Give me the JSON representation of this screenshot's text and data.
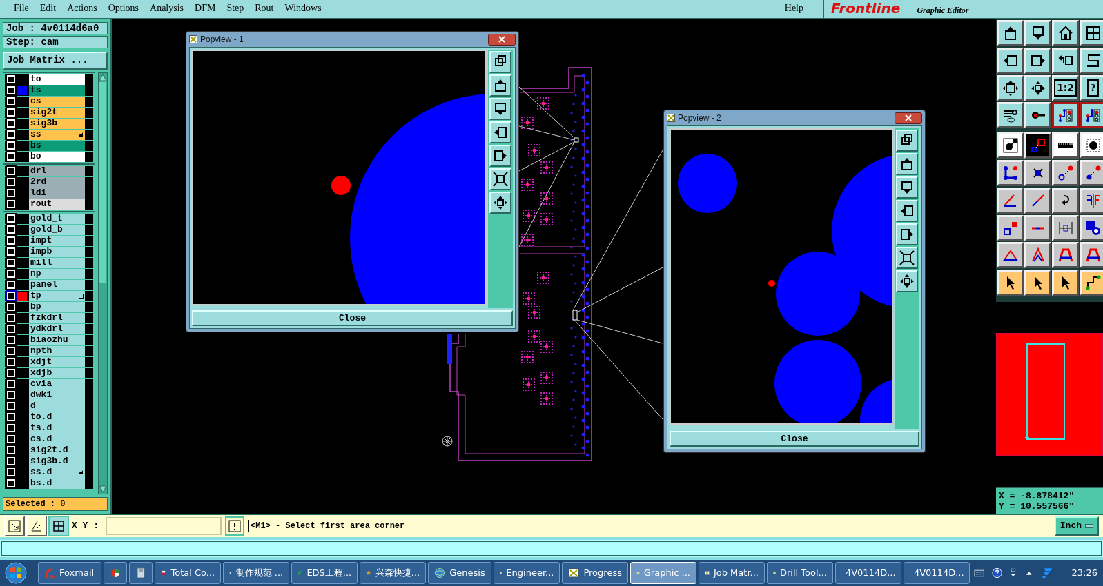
{
  "menu": [
    "File",
    "Edit",
    "Actions",
    "Options",
    "Analysis",
    "DFM",
    "Step",
    "Rout",
    "Windows"
  ],
  "help_menu": "Help",
  "logo": {
    "text": "Frontline",
    "subtitle": "Graphic Editor"
  },
  "job_label": "Job : 4v0114d6a0",
  "step_label": "Step: cam",
  "job_matrix_button": "Job Matrix ...",
  "layer_groups": [
    {
      "layers": [
        {
          "name": "to",
          "kind": "silk",
          "checked": false,
          "selected": false
        },
        {
          "name": "ts",
          "kind": "mask",
          "color": "#0000ff",
          "checked": false,
          "selected": false
        },
        {
          "name": "cs",
          "kind": "signal",
          "checked": false,
          "selected": false
        },
        {
          "name": "sig2t",
          "kind": "signal",
          "checked": false,
          "selected": false
        },
        {
          "name": "sig3b",
          "kind": "signal",
          "checked": false,
          "selected": false
        },
        {
          "name": "ss",
          "kind": "signal",
          "hand_mark": true,
          "checked": false,
          "selected": false
        },
        {
          "name": "bs",
          "kind": "mask",
          "checked": false,
          "selected": false
        },
        {
          "name": "bo",
          "kind": "silk",
          "checked": false,
          "selected": false
        }
      ]
    },
    {
      "layers": [
        {
          "name": "drl",
          "kind": "drill",
          "checked": false,
          "selected": false
        },
        {
          "name": "2rd",
          "kind": "drill",
          "checked": false,
          "selected": false
        },
        {
          "name": "ldi",
          "kind": "drill",
          "checked": false,
          "selected": false
        },
        {
          "name": "rout",
          "kind": "rout",
          "checked": false,
          "selected": false
        }
      ]
    },
    {
      "layers": [
        {
          "name": "gold_t",
          "kind": "misc",
          "checked": false,
          "selected": false
        },
        {
          "name": "gold_b",
          "kind": "misc",
          "checked": false,
          "selected": false
        },
        {
          "name": "impt",
          "kind": "misc",
          "checked": false,
          "selected": false
        },
        {
          "name": "impb",
          "kind": "misc",
          "checked": false,
          "selected": false
        },
        {
          "name": "mill",
          "kind": "misc",
          "checked": false,
          "selected": false
        },
        {
          "name": "np",
          "kind": "misc",
          "checked": false,
          "selected": false
        },
        {
          "name": "panel",
          "kind": "misc",
          "checked": false,
          "selected": false
        },
        {
          "name": "tp",
          "kind": "misc",
          "color": "#ff0000",
          "grid_mark": true,
          "checked": false,
          "selected": true
        },
        {
          "name": "bp",
          "kind": "misc",
          "checked": false,
          "selected": false
        },
        {
          "name": "fzkdrl",
          "kind": "misc",
          "checked": false,
          "selected": false
        },
        {
          "name": "ydkdrl",
          "kind": "misc",
          "checked": false,
          "selected": false
        },
        {
          "name": "biaozhu",
          "kind": "misc",
          "checked": false,
          "selected": false
        },
        {
          "name": "npth",
          "kind": "misc",
          "checked": false,
          "selected": false
        },
        {
          "name": "xdjt",
          "kind": "misc",
          "checked": false,
          "selected": false
        },
        {
          "name": "xdjb",
          "kind": "misc",
          "checked": false,
          "selected": false
        },
        {
          "name": "cvia",
          "kind": "misc",
          "checked": false,
          "selected": false
        },
        {
          "name": "dwk1",
          "kind": "misc",
          "checked": false,
          "selected": false
        },
        {
          "name": "d",
          "kind": "misc",
          "checked": false,
          "selected": false
        },
        {
          "name": "to.d",
          "kind": "misc",
          "checked": false,
          "selected": false
        },
        {
          "name": "ts.d",
          "kind": "misc",
          "checked": false,
          "selected": false
        },
        {
          "name": "cs.d",
          "kind": "misc",
          "checked": false,
          "selected": false
        },
        {
          "name": "sig2t.d",
          "kind": "misc",
          "checked": false,
          "selected": false
        },
        {
          "name": "sig3b.d",
          "kind": "misc",
          "checked": false,
          "selected": false
        },
        {
          "name": "ss.d",
          "kind": "misc",
          "hand_mark": true,
          "checked": false,
          "selected": false
        },
        {
          "name": "bs.d",
          "kind": "misc",
          "checked": false,
          "selected": false
        }
      ]
    }
  ],
  "selected_label": "Selected : 0",
  "popviews": [
    {
      "title": "Popview - 1",
      "close_button": "Close"
    },
    {
      "title": "Popview - 2",
      "close_button": "Close"
    }
  ],
  "tool_rows": [
    {
      "kind": "view",
      "tools": [
        {
          "kind": "up",
          "selected": false
        },
        {
          "kind": "down",
          "selected": false
        },
        {
          "kind": "house",
          "selected": false
        },
        {
          "kind": "panes",
          "selected": false
        }
      ]
    },
    {
      "kind": "view",
      "tools": [
        {
          "kind": "left",
          "selected": false
        },
        {
          "kind": "right",
          "selected": false
        },
        {
          "kind": "undo",
          "selected": false
        },
        {
          "kind": "zigzag",
          "selected": false
        }
      ]
    },
    {
      "kind": "view",
      "tools": [
        {
          "kind": "fit",
          "selected": false
        },
        {
          "kind": "squeeze",
          "selected": false
        },
        {
          "kind": "text",
          "label": "1:2",
          "selected": false
        },
        {
          "kind": "text",
          "label": "?",
          "selected": false
        }
      ]
    },
    {
      "kind": "view",
      "tools": [
        {
          "kind": "wrench",
          "selected": false
        },
        {
          "kind": "pin",
          "selected": false
        },
        {
          "kind": "circuit",
          "selected": true
        },
        {
          "kind": "circuit",
          "selected": true
        }
      ]
    },
    {
      "kind": "edit",
      "tools": [
        {
          "kind": "dot-arrow",
          "selected": false
        },
        {
          "kind": "snap",
          "selected": false
        },
        {
          "kind": "ruler",
          "selected": false
        },
        {
          "kind": "dot-frame",
          "selected": false
        }
      ]
    },
    {
      "kind": "edit",
      "tools": [
        {
          "kind": "nodes",
          "selected": false
        },
        {
          "kind": "cross",
          "selected": false
        },
        {
          "kind": "ring-arrow",
          "selected": false
        },
        {
          "kind": "dot-arrow2",
          "selected": false
        }
      ]
    },
    {
      "kind": "edit",
      "tools": [
        {
          "kind": "slant",
          "selected": false
        },
        {
          "kind": "slant2",
          "selected": false
        },
        {
          "kind": "curl",
          "selected": false
        },
        {
          "kind": "mirror",
          "selected": false
        }
      ]
    },
    {
      "kind": "edit",
      "tools": [
        {
          "kind": "squares",
          "selected": false
        },
        {
          "kind": "bar",
          "selected": false
        },
        {
          "kind": "measure",
          "selected": false
        },
        {
          "kind": "blobs",
          "selected": false
        }
      ]
    },
    {
      "kind": "edit",
      "tools": [
        {
          "kind": "triangle",
          "selected": false
        },
        {
          "kind": "peak",
          "selected": false
        },
        {
          "kind": "arch",
          "selected": false
        },
        {
          "kind": "arch",
          "selected": false
        }
      ]
    },
    {
      "kind": "select",
      "tools": [
        {
          "kind": "pointer",
          "selected": false
        },
        {
          "kind": "pointer",
          "selected": false
        },
        {
          "kind": "pointer",
          "selected": false
        },
        {
          "kind": "route",
          "selected": false
        }
      ]
    }
  ],
  "coordinates": {
    "x": "X = -8.878412\"",
    "y": "Y = 10.557566\""
  },
  "command_bar": {
    "xy_label": "X Y :",
    "message": "<M1> - Select first area corner",
    "units": "Inch"
  },
  "taskbar": {
    "items": [
      {
        "label": "Foxmail",
        "selected": false
      },
      {
        "selected": false
      },
      {
        "selected": false
      },
      {
        "label": "Total Co...",
        "selected": false
      },
      {
        "label": "制作规范 ...",
        "selected": false
      },
      {
        "label": "EDS工程...",
        "selected": false
      },
      {
        "label": "兴森快捷...",
        "selected": false
      },
      {
        "label": "Genesis",
        "selected": false
      },
      {
        "label": "Engineer...",
        "selected": false
      },
      {
        "label": "Progress",
        "selected": false
      },
      {
        "label": "Graphic ...",
        "selected": true
      },
      {
        "label": "Job Matr...",
        "selected": false
      },
      {
        "label": "Drill Tool...",
        "selected": false
      },
      {
        "label": "4V0114D...",
        "selected": false
      },
      {
        "label": "4V0114D...",
        "selected": false
      }
    ],
    "clock": "23:26"
  }
}
